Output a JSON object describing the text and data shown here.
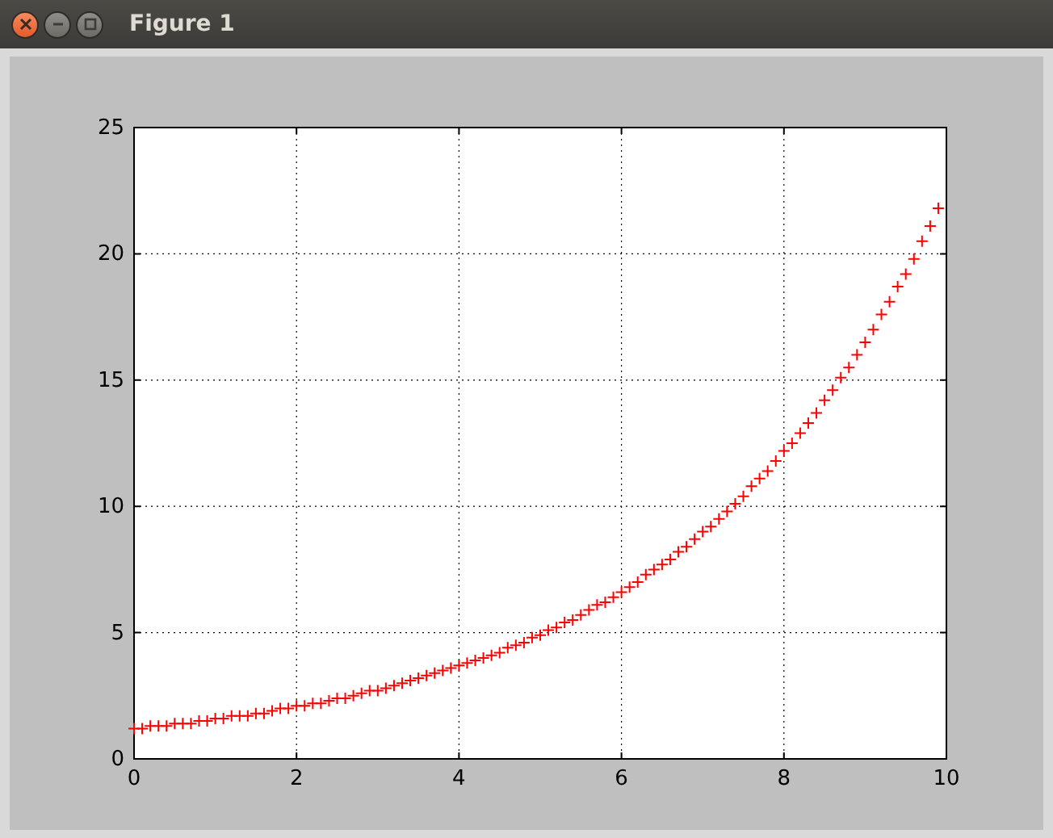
{
  "window": {
    "title": "Figure 1"
  },
  "figure": {
    "chart_data": {
      "type": "scatter",
      "x": [
        0,
        0.1,
        0.2,
        0.3,
        0.4,
        0.5,
        0.6,
        0.7,
        0.8,
        0.9,
        1,
        1.1,
        1.2,
        1.3,
        1.4,
        1.5,
        1.6,
        1.7,
        1.8,
        1.9,
        2,
        2.1,
        2.2,
        2.3,
        2.4,
        2.5,
        2.6,
        2.7,
        2.8,
        2.9,
        3,
        3.1,
        3.2,
        3.3,
        3.4,
        3.5,
        3.6,
        3.7,
        3.8,
        3.9,
        4,
        4.1,
        4.2,
        4.3,
        4.4,
        4.5,
        4.6,
        4.7,
        4.8,
        4.9,
        5,
        5.1,
        5.2,
        5.3,
        5.4,
        5.5,
        5.6,
        5.7,
        5.8,
        5.9,
        6,
        6.1,
        6.2,
        6.3,
        6.4,
        6.5,
        6.6,
        6.7,
        6.8,
        6.9,
        7,
        7.1,
        7.2,
        7.3,
        7.4,
        7.5,
        7.6,
        7.7,
        7.8,
        7.9,
        8,
        8.1,
        8.2,
        8.3,
        8.4,
        8.5,
        8.6,
        8.7,
        8.8,
        8.9,
        9,
        9.1,
        9.2,
        9.3,
        9.4,
        9.5,
        9.6,
        9.7,
        9.8,
        9.9
      ],
      "series": [
        {
          "color": "#ff0000",
          "values": [
            1.2,
            1.2,
            1.3,
            1.3,
            1.3,
            1.4,
            1.4,
            1.4,
            1.5,
            1.5,
            1.6,
            1.6,
            1.7,
            1.7,
            1.7,
            1.8,
            1.8,
            1.9,
            2.0,
            2.0,
            2.1,
            2.1,
            2.2,
            2.2,
            2.3,
            2.4,
            2.4,
            2.5,
            2.6,
            2.7,
            2.7,
            2.8,
            2.9,
            3.0,
            3.1,
            3.2,
            3.3,
            3.4,
            3.5,
            3.6,
            3.7,
            3.8,
            3.9,
            4.0,
            4.1,
            4.2,
            4.4,
            4.5,
            4.6,
            4.8,
            4.9,
            5.1,
            5.2,
            5.4,
            5.5,
            5.7,
            5.9,
            6.1,
            6.2,
            6.4,
            6.6,
            6.8,
            7.0,
            7.3,
            7.5,
            7.7,
            7.9,
            8.2,
            8.4,
            8.7,
            9.0,
            9.2,
            9.5,
            9.8,
            10.1,
            10.4,
            10.8,
            11.1,
            11.4,
            11.8,
            12.2,
            12.5,
            12.9,
            13.3,
            13.7,
            14.2,
            14.6,
            15.1,
            15.5,
            16.0,
            16.5,
            17.0,
            17.6,
            18.1,
            18.7,
            19.2,
            19.8,
            20.5,
            21.1,
            21.8
          ]
        }
      ],
      "grid": true,
      "xlim": [
        0,
        10
      ],
      "ylim": [
        0,
        25
      ],
      "xticks": [
        0,
        2,
        4,
        6,
        8,
        10
      ],
      "yticks": [
        0,
        5,
        10,
        15,
        20,
        25
      ]
    }
  }
}
